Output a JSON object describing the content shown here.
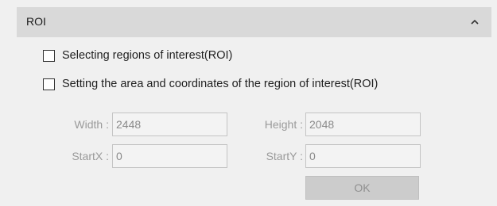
{
  "section": {
    "title": "ROI",
    "collapse_icon": "chevron-up-icon"
  },
  "options": {
    "select_roi": {
      "label": "Selecting regions of interest(ROI)",
      "checked": false
    },
    "set_roi_area": {
      "label": "Setting the area and coordinates of the region of interest(ROI)",
      "checked": false
    }
  },
  "fields": {
    "width": {
      "label": "Width :",
      "value": "2448"
    },
    "height": {
      "label": "Height :",
      "value": "2048"
    },
    "start_x": {
      "label": "StartX :",
      "value": "0"
    },
    "start_y": {
      "label": "StartY :",
      "value": "0"
    }
  },
  "buttons": {
    "ok": {
      "label": "OK",
      "enabled": false
    }
  },
  "colors": {
    "header_bg": "#d9d9d9",
    "panel_bg": "#f0f0f0",
    "disabled_text": "#9a9a9a",
    "disabled_button_bg": "#cccccc"
  }
}
